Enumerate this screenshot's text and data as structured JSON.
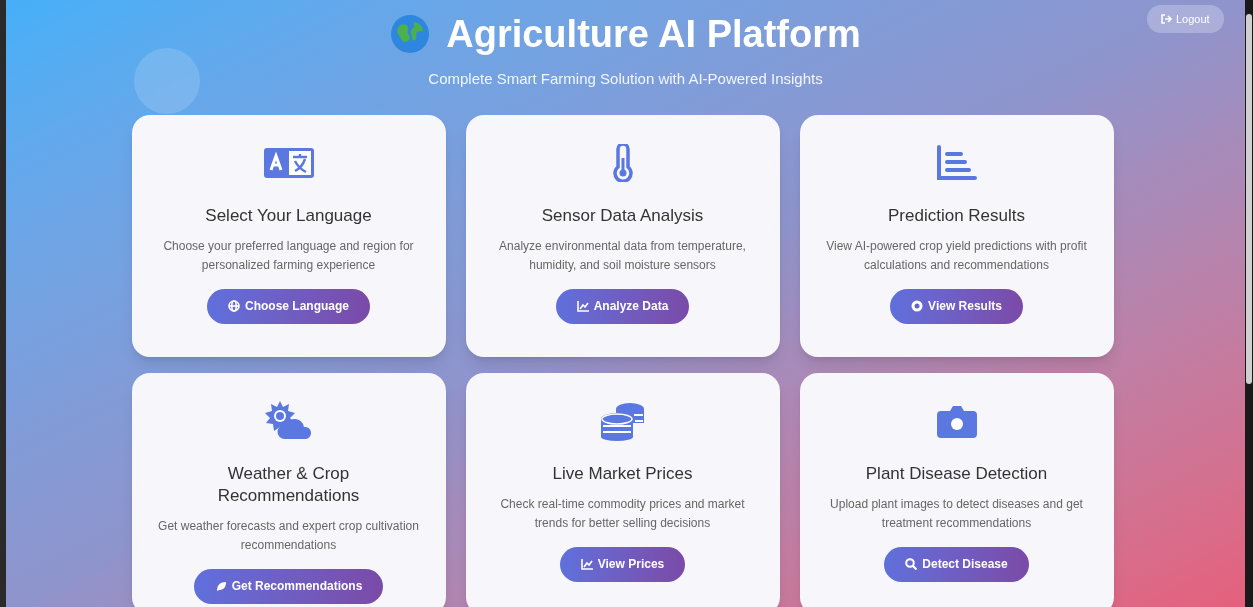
{
  "header": {
    "title": "Agriculture AI Platform",
    "subtitle": "Complete Smart Farming Solution with AI-Powered Insights"
  },
  "logout": {
    "label": "Logout"
  },
  "cards": [
    {
      "title": "Select Your Language",
      "description": "Choose your preferred language and region for personalized farming experience",
      "button": "Choose Language"
    },
    {
      "title": "Sensor Data Analysis",
      "description": "Analyze environmental data from temperature, humidity, and soil moisture sensors",
      "button": "Analyze Data"
    },
    {
      "title": "Prediction Results",
      "description": "View AI-powered crop yield predictions with profit calculations and recommendations",
      "button": "View Results"
    },
    {
      "title": "Weather & Crop Recommendations",
      "description": "Get weather forecasts and expert crop cultivation recommendations",
      "button": "Get Recommendations"
    },
    {
      "title": "Live Market Prices",
      "description": "Check real-time commodity prices and market trends for better selling decisions",
      "button": "View Prices"
    },
    {
      "title": "Plant Disease Detection",
      "description": "Upload plant images to detect diseases and get treatment recommendations",
      "button": "Detect Disease"
    }
  ]
}
